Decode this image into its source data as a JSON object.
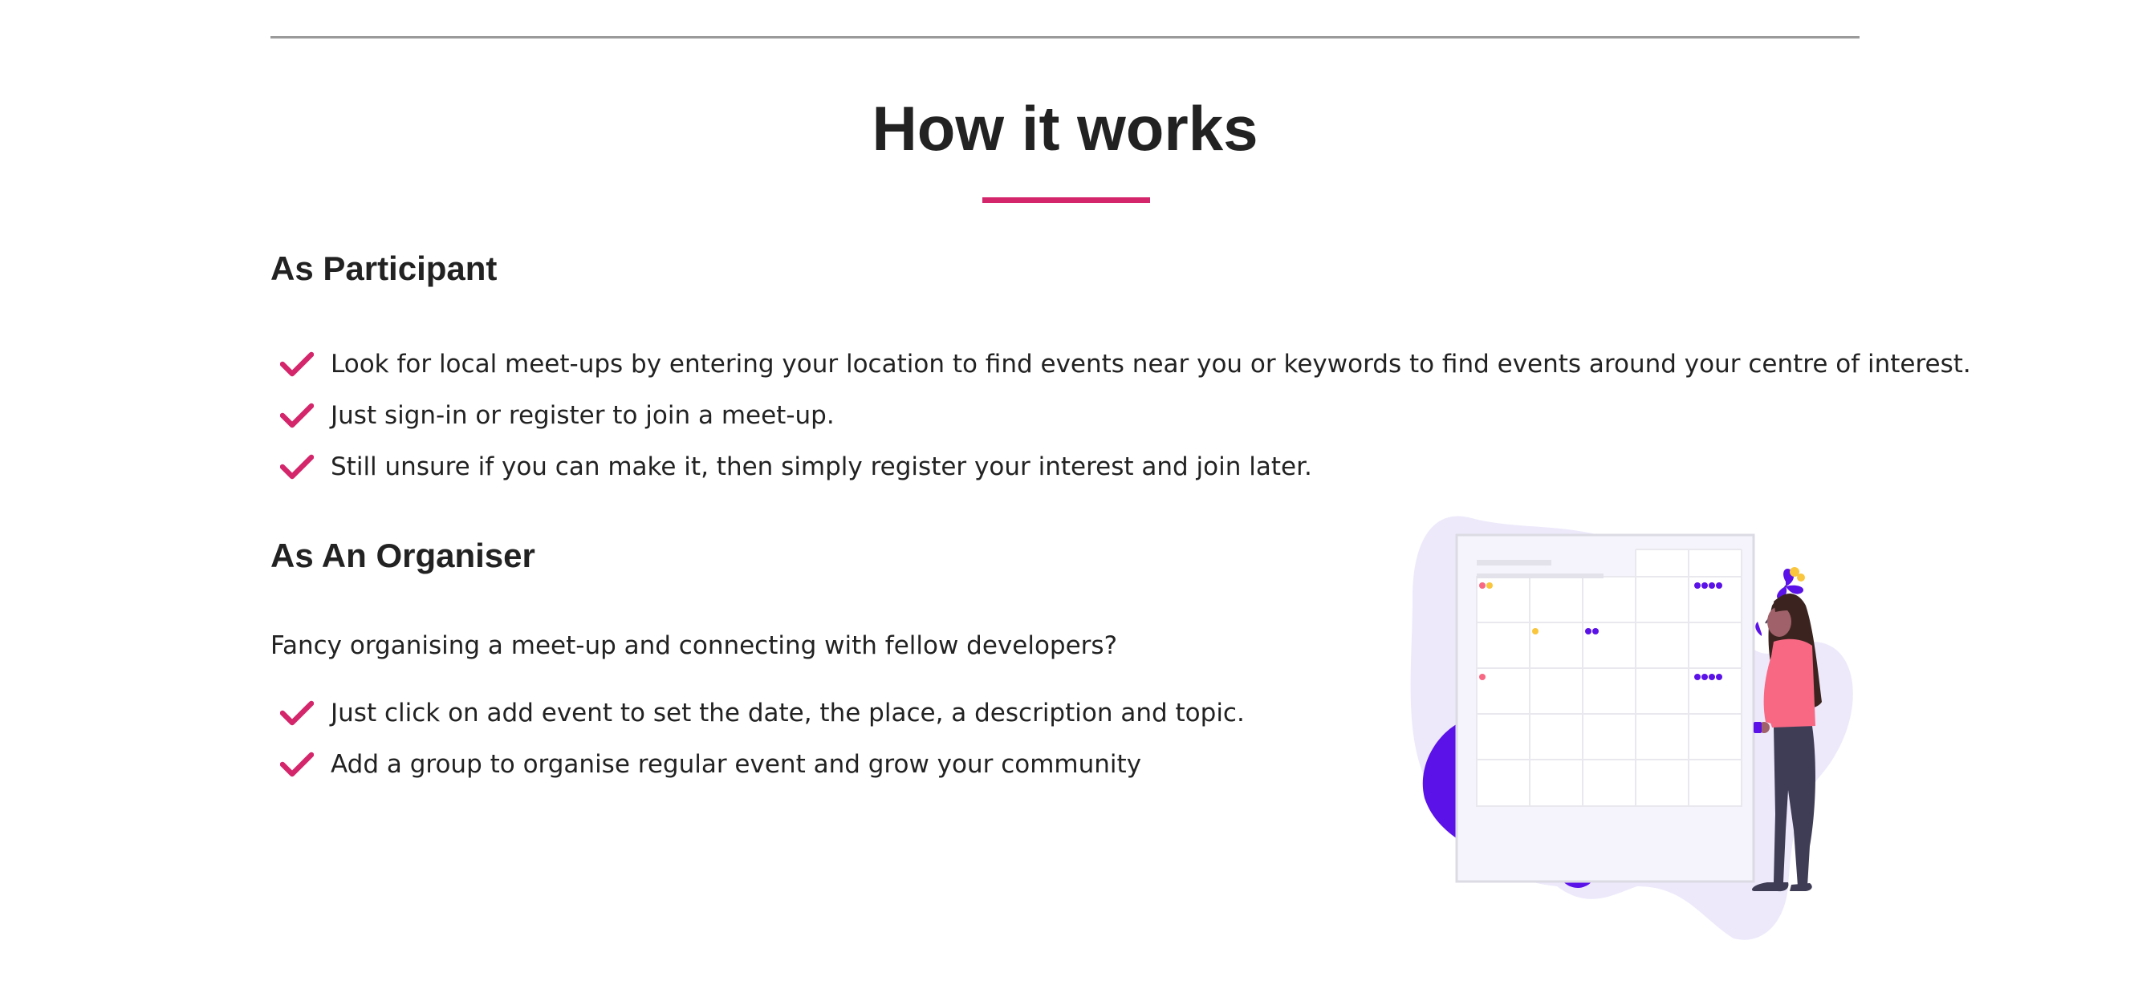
{
  "section": {
    "title": "How it works",
    "accent_color": "#d4266b"
  },
  "participant": {
    "heading": "As Participant",
    "items": [
      {
        "text": "Look for local meet-ups by entering your location to find events near you or keywords to find events around your centre of interest.",
        "icon": "check-icon"
      },
      {
        "text": "Just sign-in or register to join a meet-up.",
        "icon": "check-icon"
      },
      {
        "text": "Still unsure if you can make it, then simply register your interest and join later.",
        "icon": "check-icon"
      }
    ]
  },
  "organiser": {
    "heading": "As An Organiser",
    "intro": "Fancy organising a meet-up and connecting with fellow developers?",
    "items": [
      {
        "text": "Just click on add event to set the date, the place, a description and topic.",
        "icon": "check-icon"
      },
      {
        "text": "Add a group to organise regular event and grow your community",
        "icon": "check-icon"
      }
    ]
  },
  "illustration": {
    "name": "calendar-illustration",
    "colors": {
      "blob": "#ede9fb",
      "purple": "#5b12e8",
      "shirt": "#f86883",
      "hair": "#3b2420",
      "pants": "#3f3d56",
      "yellow": "#f9c63e"
    }
  }
}
